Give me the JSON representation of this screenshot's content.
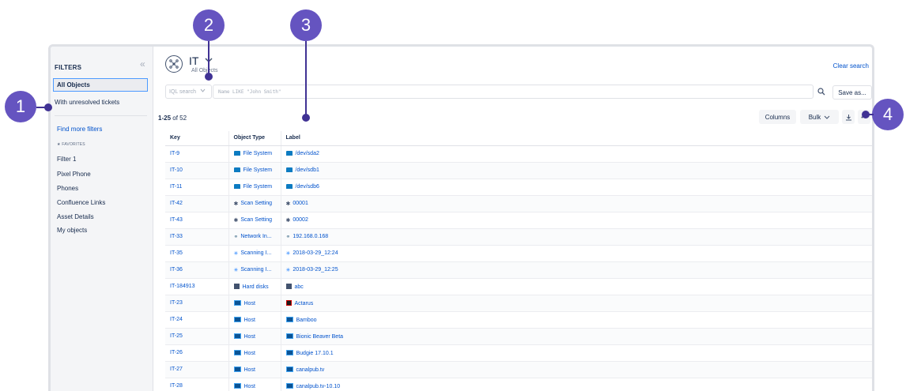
{
  "sidebar": {
    "title": "FILTERS",
    "collapse_icon": "«",
    "items": [
      {
        "label": "All Objects",
        "selected": true
      },
      {
        "label": "With unresolved tickets"
      }
    ],
    "find_more": "Find more filters",
    "favorites_title": "★ FAVORITES",
    "favorites": [
      "Filter 1",
      "Pixel Phone",
      "Phones",
      "Confluence Links",
      "Asset Details",
      "My objects"
    ]
  },
  "header": {
    "schema_name": "IT",
    "schema_sub": "All Objects",
    "clear_search": "Clear search"
  },
  "search": {
    "mode": "IQL search",
    "placeholder": "Name LIKE \"John Smith\"",
    "save_label": "Save as..."
  },
  "results": {
    "range": "1-25",
    "of_label": "of 52",
    "columns_label": "Columns",
    "bulk_label": "Bulk"
  },
  "table": {
    "headers": [
      "Key",
      "Object Type",
      "Label"
    ],
    "rows": [
      {
        "key": "IT-9",
        "type": "File System",
        "type_icon": "folder-icon",
        "label": "/dev/sda2",
        "label_icon": "folder-icon"
      },
      {
        "key": "IT-10",
        "type": "File System",
        "type_icon": "folder-icon",
        "label": "/dev/sdb1",
        "label_icon": "folder-icon"
      },
      {
        "key": "IT-11",
        "type": "File System",
        "type_icon": "folder-icon",
        "label": "/dev/sdb6",
        "label_icon": "folder-icon"
      },
      {
        "key": "IT-42",
        "type": "Scan Setting",
        "type_icon": "gear-icon",
        "label": "00001",
        "label_icon": "gear-icon"
      },
      {
        "key": "IT-43",
        "type": "Scan Setting",
        "type_icon": "gear-icon",
        "label": "00002",
        "label_icon": "gear-icon"
      },
      {
        "key": "IT-33",
        "type": "Network In...",
        "type_icon": "network-icon",
        "label": "192.168.0.168",
        "label_icon": "network-icon"
      },
      {
        "key": "IT-35",
        "type": "Scanning I...",
        "type_icon": "scan-icon",
        "label": "2018-03-29_12:24",
        "label_icon": "scan-icon"
      },
      {
        "key": "IT-36",
        "type": "Scanning I...",
        "type_icon": "scan-icon",
        "label": "2018-03-29_12:25",
        "label_icon": "scan-icon"
      },
      {
        "key": "IT-184913",
        "type": "Hard disks",
        "type_icon": "disk-icon",
        "label": "abc",
        "label_icon": "disk-icon"
      },
      {
        "key": "IT-23",
        "type": "Host",
        "type_icon": "host-icon",
        "label": "Actarus",
        "label_icon": "actarus-icon"
      },
      {
        "key": "IT-24",
        "type": "Host",
        "type_icon": "host-icon",
        "label": "Bamboo",
        "label_icon": "host-icon"
      },
      {
        "key": "IT-25",
        "type": "Host",
        "type_icon": "host-icon",
        "label": "Bionic Beaver Beta",
        "label_icon": "host-icon"
      },
      {
        "key": "IT-26",
        "type": "Host",
        "type_icon": "host-icon",
        "label": "Budgie 17.10.1",
        "label_icon": "host-icon"
      },
      {
        "key": "IT-27",
        "type": "Host",
        "type_icon": "host-icon",
        "label": "canalpub.tv",
        "label_icon": "host-icon"
      },
      {
        "key": "IT-28",
        "type": "Host",
        "type_icon": "host-icon",
        "label": "canalpub.tv-10.10",
        "label_icon": "host-icon"
      }
    ]
  },
  "callouts": [
    "1",
    "2",
    "3",
    "4"
  ],
  "colors": {
    "callout": "#6554c0",
    "link": "#0052cc",
    "selected_border": "#4c9aff"
  }
}
